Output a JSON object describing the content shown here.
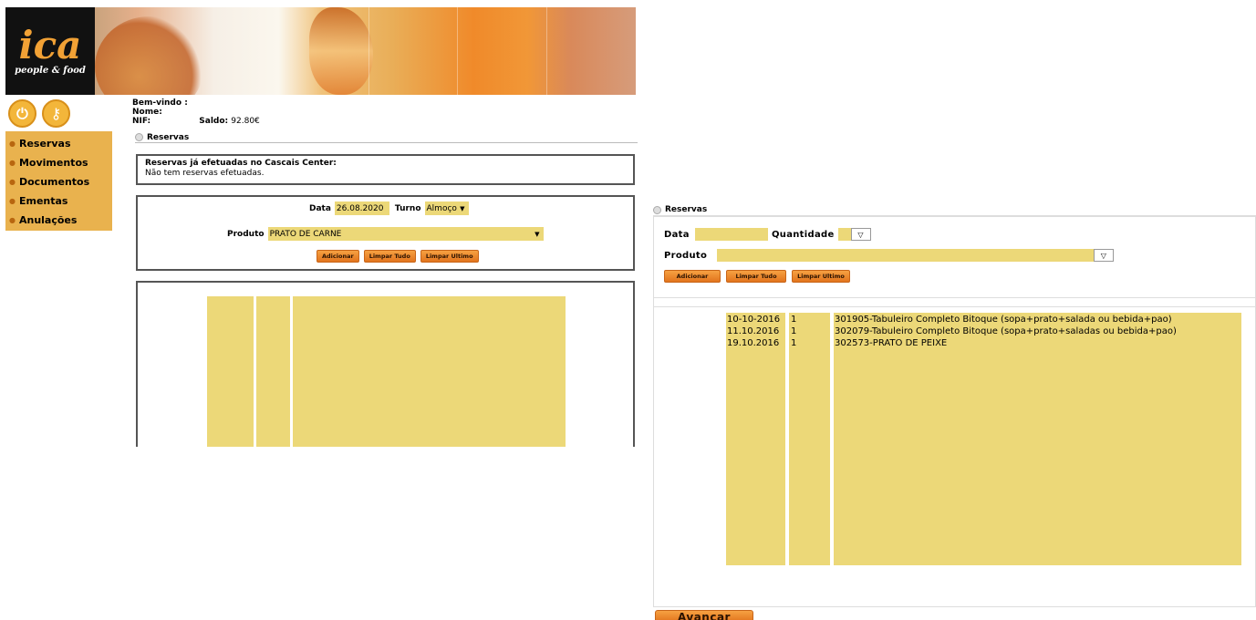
{
  "left": {
    "logo": {
      "text": "ica",
      "sub": "people & food"
    },
    "menu": [
      "Reservas",
      "Movimentos",
      "Documentos",
      "Ementas",
      "Anulações"
    ],
    "user": {
      "welcome": "Bem-vindo :",
      "nome": "Nome:",
      "nif": "NIF:",
      "saldo_label": "Saldo:",
      "saldo_value": "92.80€"
    },
    "section_title": "Reservas",
    "info_title": "Reservas já efetuadas no Cascais Center:",
    "info_text": "Não tem reservas efetuadas.",
    "form": {
      "data_label": "Data",
      "data_value": "26.08.2020",
      "turno_label": "Turno",
      "turno_value": "Almoço",
      "produto_label": "Produto",
      "produto_value": "PRATO DE CARNE"
    },
    "buttons": {
      "adicionar": "Adicionar",
      "limpar_tudo": "Limpar Tudo",
      "limpar_ultimo": "Limpar Ultimo"
    }
  },
  "right": {
    "section_title": "Reservas",
    "form": {
      "data_label": "Data",
      "quantidade_label": "Quantidade",
      "produto_label": "Produto"
    },
    "buttons": {
      "adicionar": "Adicionar",
      "limpar_tudo": "Limpar Tudo",
      "limpar_ultimo": "Limpar Ultimo"
    },
    "rows": [
      {
        "date": "10-10-2016",
        "qty": "1",
        "product": "301905-Tabuleiro Completo Bitoque (sopa+prato+salada ou bebida+pao)"
      },
      {
        "date": "11.10.2016",
        "qty": "1",
        "product": "302079-Tabuleiro Completo Bitoque (sopa+prato+saladas ou bebida+pao)"
      },
      {
        "date": "19.10.2016",
        "qty": "1",
        "product": "302573-PRATO DE PEIXE"
      }
    ],
    "avancar": "Avançar"
  },
  "icons": {
    "power": "power-icon",
    "key": "key-icon",
    "caret": "chevron-down-icon"
  },
  "colors": {
    "menu_bg": "#e9b24e",
    "field_bg": "#ecd878",
    "button": "#e2741d"
  }
}
